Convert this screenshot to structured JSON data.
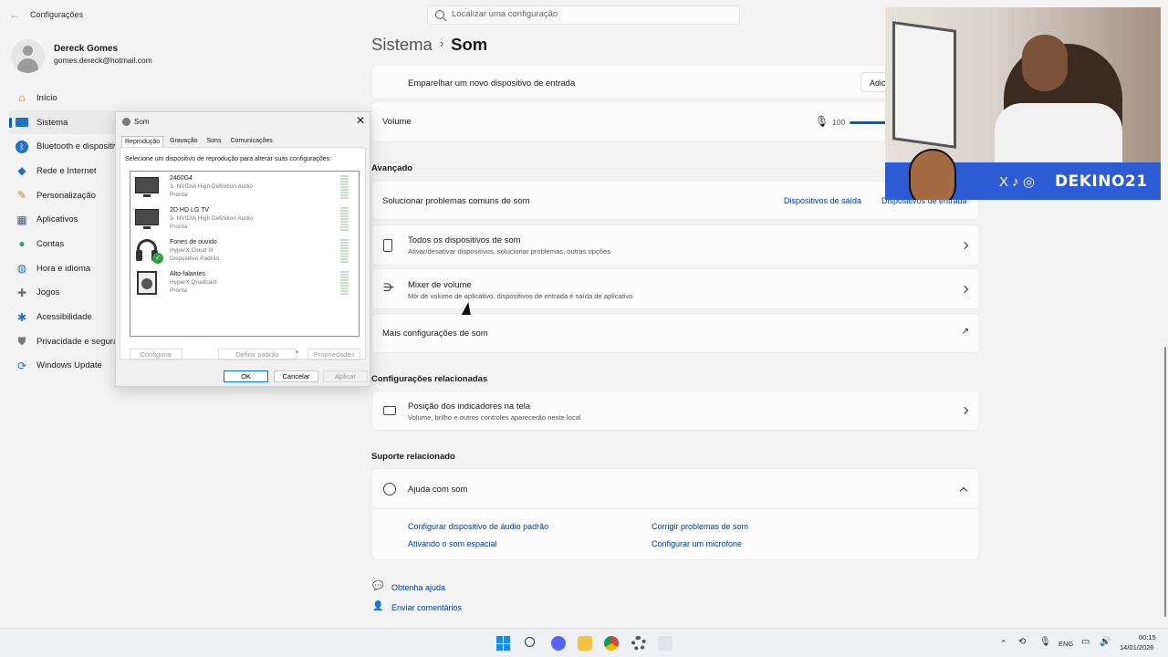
{
  "app": {
    "title": "Configurações"
  },
  "search": {
    "placeholder": "Localizar uma configuração"
  },
  "profile": {
    "name": "Dereck Gomes",
    "email": "gomes.dereck@hotmail.com"
  },
  "sidebar": {
    "items": [
      {
        "label": "Início",
        "icon": "home-icon"
      },
      {
        "label": "Sistema",
        "icon": "system-icon"
      },
      {
        "label": "Bluetooth e dispositivos",
        "icon": "bluetooth-icon"
      },
      {
        "label": "Rede e Internet",
        "icon": "wifi-icon"
      },
      {
        "label": "Personalização",
        "icon": "brush-icon"
      },
      {
        "label": "Aplicativos",
        "icon": "apps-icon"
      },
      {
        "label": "Contas",
        "icon": "accounts-icon"
      },
      {
        "label": "Hora e idioma",
        "icon": "globe-clock-icon"
      },
      {
        "label": "Jogos",
        "icon": "gamepad-icon"
      },
      {
        "label": "Acessibilidade",
        "icon": "accessibility-icon"
      },
      {
        "label": "Privacidade e segurança",
        "icon": "shield-icon"
      },
      {
        "label": "Windows Update",
        "icon": "update-icon"
      }
    ]
  },
  "breadcrumb": {
    "parent": "Sistema",
    "current": "Som"
  },
  "input": {
    "pair_label": "Emparelhar um novo dispositivo de entrada",
    "pair_button": "Adicionar dispositivo",
    "volume_label": "Volume",
    "volume_value": "100"
  },
  "advanced": {
    "heading": "Avançado",
    "troubleshoot_label": "Solucionar problemas comuns de som",
    "output_devices_link": "Dispositivos de saída",
    "input_devices_link": "Dispositivos de entrada",
    "all_devices_title": "Todos os dispositivos de som",
    "all_devices_sub": "Ativar/desativar dispositivos, solucionar problemas, outras opções",
    "mixer_title": "Mixer de volume",
    "mixer_sub": "Mix de volume de aplicativo, dispositivos de entrada e saída de aplicativo",
    "more_settings": "Mais configurações de som"
  },
  "related": {
    "heading": "Configurações relacionadas",
    "position_title": "Posição dos indicadores na tela",
    "position_sub": "Volume, brilho e outros controles aparecerão neste local"
  },
  "support": {
    "heading": "Suporte relacionado",
    "help_title": "Ajuda com som",
    "links": [
      "Configurar dispositivo de áudio padrão",
      "Corrigir problemas de som",
      "Ativando o som espacial",
      "Configurar um microfone"
    ]
  },
  "footer": {
    "get_help": "Obtenha ajuda",
    "feedback": "Enviar comentários"
  },
  "dialog": {
    "title": "Som",
    "tabs": [
      "Reprodução",
      "Gravação",
      "Sons",
      "Comunicações"
    ],
    "instruction": "Selecione um dispositivo de reprodução para alterar suas configurações:",
    "devices": [
      {
        "name": "2460G4",
        "sub1": "3- NVIDIA High Definition Audio",
        "sub2": "Pronta"
      },
      {
        "name": "2D HD LG TV",
        "sub1": "3- NVIDIA High Definition Audio",
        "sub2": "Pronta"
      },
      {
        "name": "Fones de ouvido",
        "sub1": "HyperX Cloud III",
        "sub2": "Dispositivo Padrão"
      },
      {
        "name": "Alto-falantes",
        "sub1": "HyperX Quadcast",
        "sub2": "Pronta"
      }
    ],
    "configure": "Configurar",
    "set_default": "Definir padrão",
    "properties": "Propriedades",
    "ok": "OK",
    "cancel": "Cancelar",
    "apply": "Aplicar"
  },
  "webcam": {
    "handle": "DEKINO21",
    "platform_icons": "X ♪ ◎"
  },
  "taskbar": {
    "lang": "ENG",
    "time": "00:15",
    "date": "14/01/2026"
  },
  "colors": {
    "accent": "#005fb8",
    "link": "#003e92",
    "banner": "#2d5bd4"
  }
}
